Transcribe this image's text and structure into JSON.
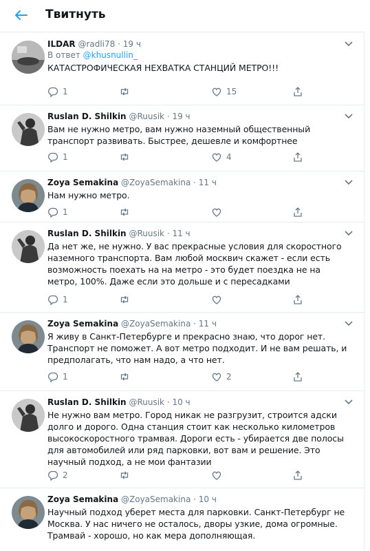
{
  "header": {
    "title": "Твитнуть"
  },
  "tweets": [
    {
      "name": "ILDAR",
      "handle": "@radli78",
      "time": "19 ч",
      "reply_prefix": "В ответ",
      "reply_to": "@khusnullin_",
      "text": "КАТАСТРОФИЧЕСКАЯ НЕХВАТКА СТАНЦИЙ МЕТРО!!!",
      "replies": "1",
      "retweets": "",
      "likes": "15"
    },
    {
      "name": "Ruslan D. Shilkin",
      "handle": "@Ruusik",
      "time": "19 ч",
      "text": "Вам не нужно метро, вам нужно наземный общественный транспорт развивать. Быстрее, дешевле и комфортнее",
      "replies": "1",
      "retweets": "",
      "likes": "4"
    },
    {
      "name": "Zoya Semakina",
      "handle": "@ZoyaSemakina",
      "time": "11 ч",
      "text": "Нам нужно метро.",
      "replies": "1",
      "retweets": "",
      "likes": ""
    },
    {
      "name": "Ruslan D. Shilkin",
      "handle": "@Ruusik",
      "time": "11 ч",
      "text": "Да нет же, не нужно. У вас прекрасные условия для скоростного наземного транспорта. Вам любой москвич скажет - если есть возможность поехать на на метро - это будет поездка не на метро, 100%. Даже если это дольше и с пересадками",
      "replies": "1",
      "retweets": "",
      "likes": ""
    },
    {
      "name": "Zoya Semakina",
      "handle": "@ZoyaSemakina",
      "time": "11 ч",
      "text": "Я живу в Санкт-Петербурге и прекрасно знаю, что дорог нет. Транспорт не поможет. А вот метро подходит. И не вам решать, и предполагать, что нам надо, а что нет.",
      "replies": "1",
      "retweets": "",
      "likes": "2"
    },
    {
      "name": "Ruslan D. Shilkin",
      "handle": "@Ruusik",
      "time": "10 ч",
      "text": "Не нужно вам метро. Город никак не разгрузит, строится адски долго и дорого. Одна станция стоит как несколько километров высокоскоростного трамвая. Дороги есть - убирается две полосы для автомобилей или ряд парковки, вот вам и решение. Это научный подход, а не мои фантазии",
      "replies": "2",
      "retweets": "",
      "likes": ""
    },
    {
      "name": "Zoya Semakina",
      "handle": "@ZoyaSemakina",
      "time": "10 ч",
      "text": "Научный подход уберет места для парковки. Санкт-Петербург не Москва. У нас ничего не осталось, дворы узкие, дома огромные. Трамвай - хорошо, но как мера дополняющая.",
      "replies": "",
      "retweets": "",
      "likes": ""
    }
  ]
}
